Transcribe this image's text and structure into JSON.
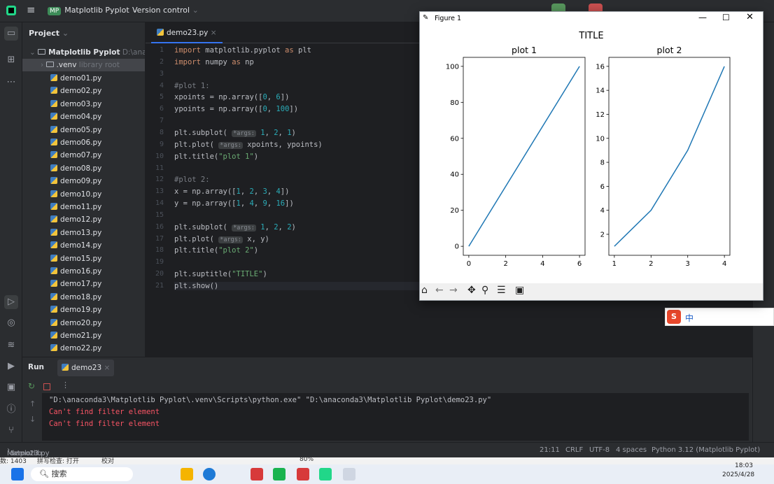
{
  "topbar": {
    "project_badge": "MP",
    "project_name": "Matplotlib Pyplot",
    "version_control": "Version control"
  },
  "project_panel": {
    "header": "Project",
    "root_name": "Matplotlib Pyplot",
    "root_path": "D:\\anacond",
    "venv_name": ".venv",
    "venv_note": "library root",
    "files": [
      "demo01.py",
      "demo02.py",
      "demo03.py",
      "demo04.py",
      "demo05.py",
      "demo06.py",
      "demo07.py",
      "demo08.py",
      "demo09.py",
      "demo10.py",
      "demo11.py",
      "demo12.py",
      "demo13.py",
      "demo14.py",
      "demo15.py",
      "demo16.py",
      "demo17.py",
      "demo18.py",
      "demo19.py",
      "demo20.py",
      "demo21.py",
      "demo22.py"
    ]
  },
  "editor": {
    "tab_name": "demo23.py",
    "hint_label": "*args:",
    "lines": [
      "import matplotlib.pyplot as plt",
      "import numpy as np",
      "",
      "#plot 1:",
      "xpoints = np.array([0, 6])",
      "ypoints = np.array([0, 100])",
      "",
      "plt.subplot( 1, 2, 1)",
      "plt.plot( xpoints, ypoints)",
      "plt.title(\"plot 1\")",
      "",
      "#plot 2:",
      "x = np.array([1, 2, 3, 4])",
      "y = np.array([1, 4, 9, 16])",
      "",
      "plt.subplot( 1, 2, 2)",
      "plt.plot( x, y)",
      "plt.title(\"plot 2\")",
      "",
      "plt.suptitle(\"TITLE\")",
      "plt.show()"
    ]
  },
  "run": {
    "label": "Run",
    "tab_name": "demo23",
    "command": "\"D:\\anaconda3\\Matplotlib Pyplot\\.venv\\Scripts\\python.exe\" \"D:\\anaconda3\\Matplotlib Pyplot\\demo23.py\"",
    "errors": [
      "Can't find filter element",
      "Can't find filter element"
    ]
  },
  "statusbar": {
    "breadcrumb_project": "Matplotlib Pyplot",
    "breadcrumb_file": "demo23.py",
    "position": "21:11",
    "line_sep": "CRLF",
    "encoding": "UTF-8",
    "indent": "4 spaces",
    "interpreter": "Python 3.12 (Matplotlib Pyplot)"
  },
  "wps": {
    "count": "数: 1403",
    "spell": "拼写检查: 打开",
    "proof": "校对",
    "zoom": "80%"
  },
  "taskbar": {
    "search_placeholder": "搜索",
    "time": "18:03",
    "date": "2025/4/28"
  },
  "ime": {
    "lang": "中"
  },
  "figure": {
    "window_title": "Figure 1",
    "suptitle": "TITLE"
  },
  "colors": {
    "line": "#1f77b4",
    "accent": "#3574f0",
    "error": "#f75464"
  },
  "chart_data": [
    {
      "type": "line",
      "title": "plot 1",
      "x": [
        0,
        6
      ],
      "y": [
        0,
        100
      ],
      "xlim": [
        -0.3,
        6.3
      ],
      "ylim": [
        -5,
        105
      ],
      "xticks": [
        0,
        2,
        4,
        6
      ],
      "yticks": [
        0,
        20,
        40,
        60,
        80,
        100
      ],
      "grid": false
    },
    {
      "type": "line",
      "title": "plot 2",
      "x": [
        1,
        2,
        3,
        4
      ],
      "y": [
        1,
        4,
        9,
        16
      ],
      "xlim": [
        0.85,
        4.15
      ],
      "ylim": [
        0.25,
        16.75
      ],
      "xticks": [
        1,
        2,
        3,
        4
      ],
      "yticks": [
        2,
        4,
        6,
        8,
        10,
        12,
        14,
        16
      ],
      "grid": false
    }
  ]
}
